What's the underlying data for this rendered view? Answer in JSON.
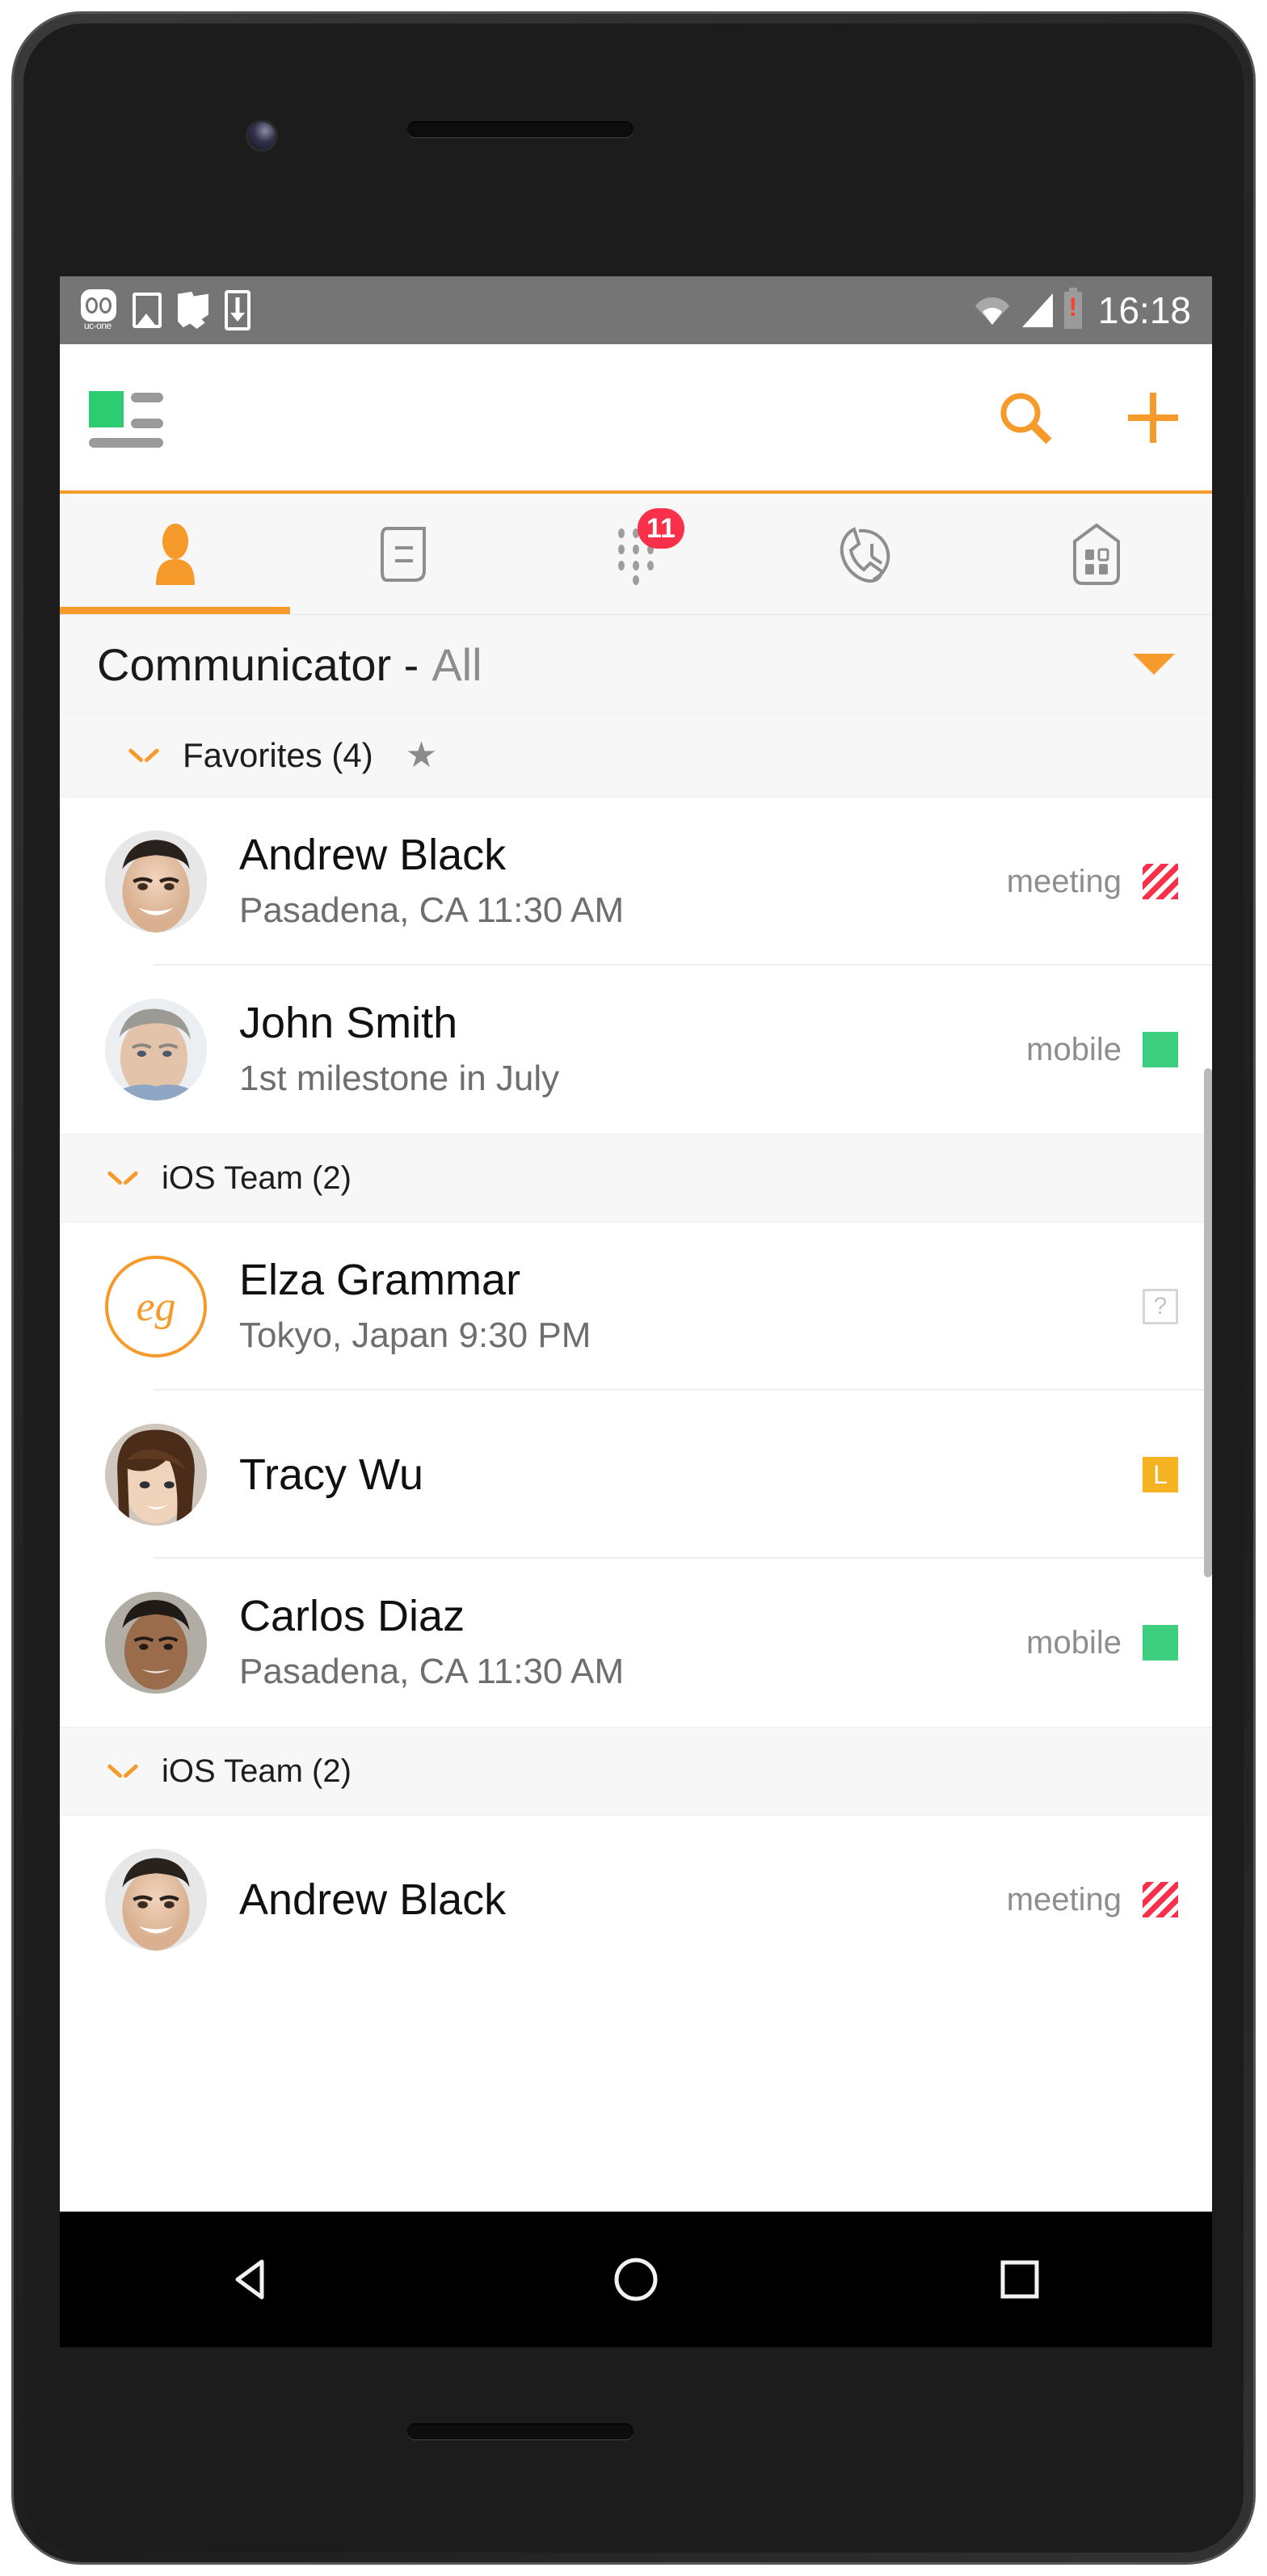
{
  "status_bar": {
    "time": "16:18",
    "left_icons": [
      "voicemail-uc-one-icon",
      "image-icon",
      "folder-icon",
      "download-icon"
    ],
    "voicemail_label": "uc-one",
    "right_icons": [
      "wifi-icon",
      "signal-icon",
      "battery-low-icon"
    ]
  },
  "app_bar": {
    "menu_icon": "menu-avatar-icon",
    "search_icon": "search-icon",
    "add_icon": "plus-icon",
    "accent_color": "#f59a2b",
    "presence_color": "#2ecc71"
  },
  "tabs": [
    {
      "name": "contacts",
      "icon": "person-icon",
      "active": true,
      "badge": ""
    },
    {
      "name": "chat",
      "icon": "message-icon",
      "active": false,
      "badge": ""
    },
    {
      "name": "dialpad",
      "icon": "dialpad-icon",
      "active": false,
      "badge": "11"
    },
    {
      "name": "call-history",
      "icon": "phone-clock-icon",
      "active": false,
      "badge": ""
    },
    {
      "name": "keypad",
      "icon": "grid-door-icon",
      "active": false,
      "badge": ""
    }
  ],
  "section": {
    "title": "Communicator -",
    "filter": "All",
    "caret_icon": "chevron-down-icon"
  },
  "groups": [
    {
      "id": "favorites",
      "label": "Favorites (4)",
      "expanded": true,
      "star_icon": "star-icon",
      "contacts": [
        {
          "name": "Andrew Black",
          "subtitle": "Pasadena, CA 11:30 AM",
          "status_label": "meeting",
          "status_type": "busy",
          "avatar_type": "photo",
          "avatar_key": "andrew"
        },
        {
          "name": "John Smith",
          "subtitle": "1st milestone in July",
          "status_label": "mobile",
          "status_type": "available",
          "avatar_type": "photo",
          "avatar_key": "john"
        }
      ]
    },
    {
      "id": "ios-team-1",
      "label": "iOS Team (2)",
      "expanded": true,
      "star_icon": "",
      "contacts": [
        {
          "name": "Elza Grammar",
          "subtitle": "Tokyo, Japan 9:30 PM",
          "status_label": "",
          "status_type": "unknown",
          "status_glyph": "?",
          "avatar_type": "initials",
          "avatar_initials": "eg"
        },
        {
          "name": "Tracy Wu",
          "subtitle": "",
          "status_label": "",
          "status_type": "away",
          "status_glyph": "L",
          "avatar_type": "photo",
          "avatar_key": "tracy"
        },
        {
          "name": "Carlos Diaz",
          "subtitle": "Pasadena, CA 11:30 AM",
          "status_label": "mobile",
          "status_type": "available",
          "avatar_type": "photo",
          "avatar_key": "carlos"
        }
      ]
    },
    {
      "id": "ios-team-2",
      "label": "iOS Team (2)",
      "expanded": true,
      "star_icon": "",
      "contacts": [
        {
          "name": "Andrew Black",
          "subtitle": "",
          "status_label": "meeting",
          "status_type": "busy",
          "avatar_type": "photo",
          "avatar_key": "andrew"
        }
      ]
    }
  ],
  "nav_bar": {
    "back_icon": "back-triangle-icon",
    "home_icon": "home-circle-icon",
    "recents_icon": "recents-square-icon"
  }
}
